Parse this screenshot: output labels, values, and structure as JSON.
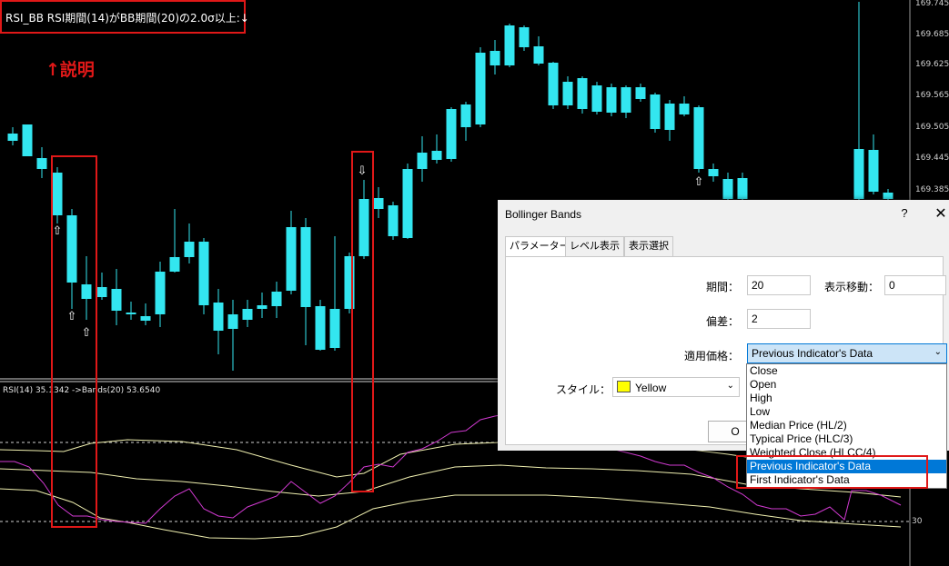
{
  "chart": {
    "title": "RSI_BB RSI期間(14)がBB期間(20)の2.0σ以上:↓",
    "explain": "↑説明",
    "rsi_label": "RSI(14) 35.1342  ->Bands(20) 53.6540",
    "price_labels": [
      "169.745",
      "169.685",
      "169.625",
      "169.565",
      "169.505",
      "169.445",
      "169.385"
    ],
    "rsi_level_label": "30",
    "colors": {
      "bull": "#ffff00",
      "bear": "#33e6f0",
      "rsi": "#d23ad2",
      "bands": "#f0f0b0",
      "frame": "#e01818"
    }
  },
  "dialog": {
    "title": "Bollinger Bands",
    "help": "?",
    "close": "✕",
    "tabs": [
      "パラメーター",
      "レベル表示",
      "表示選択"
    ],
    "period_label": "期間：",
    "period_value": "20",
    "shift_label": "表示移動：",
    "shift_value": "0",
    "deviation_label": "偏差：",
    "deviation_value": "2",
    "apply_label": "適用価格：",
    "apply_value": "Previous Indicator's Data",
    "style_label": "スタイル：",
    "style_value": "Yellow",
    "ok_label": "O"
  },
  "dropdown": {
    "options": [
      "Close",
      "Open",
      "High",
      "Low",
      "Median Price (HL/2)",
      "Typical Price (HLC/3)",
      "Weighted Close (HLCC/4)",
      "Previous Indicator's Data",
      "First Indicator's Data"
    ],
    "selected": "Previous Indicator's Data"
  }
}
